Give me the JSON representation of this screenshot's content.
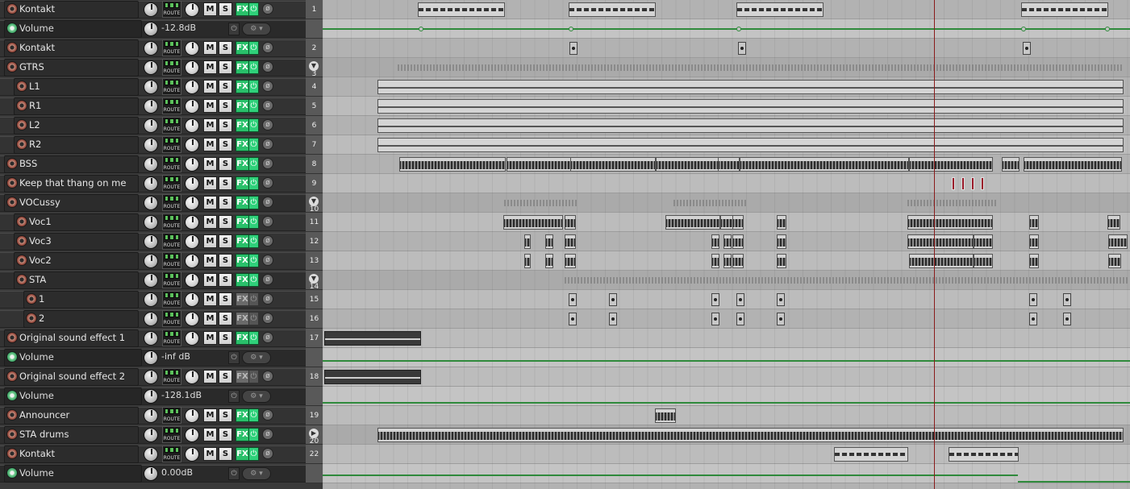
{
  "colors": {
    "fx_active": "#29c06a",
    "fx_bypassed": "#6a6a6a",
    "envelope": "#2f8a3c",
    "play_cursor": "#8a1a1a",
    "region_marker": "#9a1a2a"
  },
  "buttons": {
    "route": "ROUTE",
    "mute": "M",
    "solo": "S",
    "fx": "FX",
    "power": "⏻",
    "phase": "ø",
    "env_arm": "⏻",
    "env_settings": "⚙ ▾"
  },
  "tracks": [
    {
      "kind": "track",
      "name": "Kontakt",
      "number": "1",
      "indent": 0,
      "fx": "on"
    },
    {
      "kind": "env",
      "name": "Volume",
      "value": "-12.8dB",
      "parent": "1"
    },
    {
      "kind": "track",
      "name": "Kontakt",
      "number": "2",
      "indent": 0,
      "fx": "on"
    },
    {
      "kind": "folder",
      "name": "GTRS",
      "number": "3",
      "indent": 0,
      "fx": "on",
      "folder_icon": "▼"
    },
    {
      "kind": "track",
      "name": "L1",
      "number": "4",
      "indent": 1,
      "fx": "on"
    },
    {
      "kind": "track",
      "name": "R1",
      "number": "5",
      "indent": 1,
      "fx": "on"
    },
    {
      "kind": "track",
      "name": "L2",
      "number": "6",
      "indent": 1,
      "fx": "on"
    },
    {
      "kind": "track",
      "name": "R2",
      "number": "7",
      "indent": 1,
      "fx": "on"
    },
    {
      "kind": "track",
      "name": "BSS",
      "number": "8",
      "indent": 0,
      "fx": "on"
    },
    {
      "kind": "track",
      "name": "Keep that thang on me",
      "number": "9",
      "indent": 0,
      "fx": "on"
    },
    {
      "kind": "folder",
      "name": "VOCussy",
      "number": "10",
      "indent": 0,
      "fx": "on",
      "folder_icon": "▼"
    },
    {
      "kind": "track",
      "name": "Voc1",
      "number": "11",
      "indent": 1,
      "fx": "on"
    },
    {
      "kind": "track",
      "name": "Voc3",
      "number": "12",
      "indent": 1,
      "fx": "on"
    },
    {
      "kind": "track",
      "name": "Voc2",
      "number": "13",
      "indent": 1,
      "fx": "on"
    },
    {
      "kind": "folder",
      "name": "STA",
      "number": "14",
      "indent": 1,
      "fx": "on",
      "folder_icon": "▼"
    },
    {
      "kind": "track",
      "name": "1",
      "number": "15",
      "indent": 2,
      "fx": "off"
    },
    {
      "kind": "track",
      "name": "2",
      "number": "16",
      "indent": 2,
      "fx": "off"
    },
    {
      "kind": "track",
      "name": "Original sound effect 1",
      "number": "17",
      "indent": 0,
      "fx": "on"
    },
    {
      "kind": "env",
      "name": "Volume",
      "value": "-inf dB",
      "parent": "17"
    },
    {
      "kind": "track",
      "name": "Original sound effect 2",
      "number": "18",
      "indent": 0,
      "fx": "off"
    },
    {
      "kind": "env",
      "name": "Volume",
      "value": "-128.1dB",
      "parent": "18"
    },
    {
      "kind": "track",
      "name": "Announcer",
      "number": "19",
      "indent": 0,
      "fx": "on"
    },
    {
      "kind": "folder",
      "name": "STA drums",
      "number": "20",
      "indent": 0,
      "fx": "on",
      "folder_icon": "▶"
    },
    {
      "kind": "track",
      "name": "Kontakt",
      "number": "22",
      "indent": 0,
      "fx": "on"
    },
    {
      "kind": "env",
      "name": "Volume",
      "value": "0.00dB",
      "parent": "22"
    }
  ]
}
